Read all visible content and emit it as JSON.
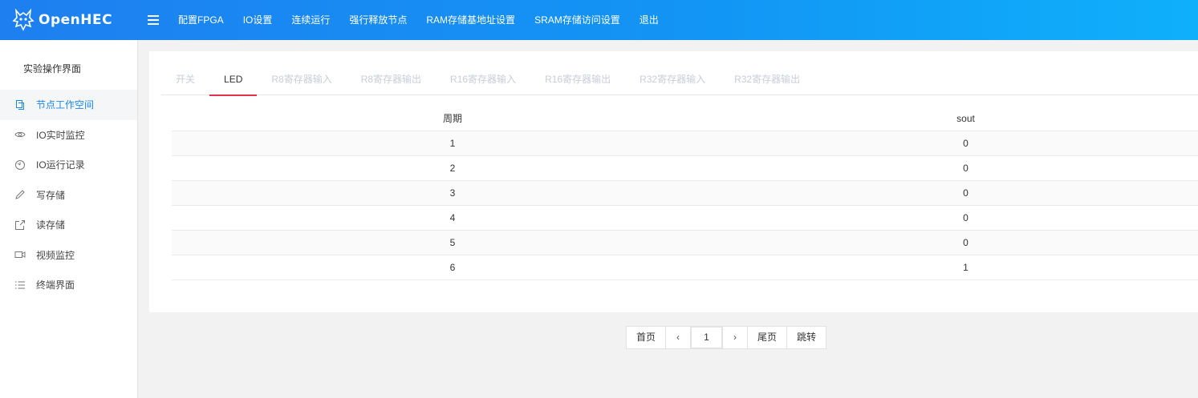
{
  "header": {
    "logo_text": "OpenHEC",
    "menu_icon": "hamburger-icon",
    "nav": [
      "配置FPGA",
      "IO设置",
      "连续运行",
      "强行释放节点",
      "RAM存储基地址设置",
      "SRAM存储访问设置",
      "退出"
    ]
  },
  "sidebar": {
    "title": "实验操作界面",
    "items": [
      {
        "label": "节点工作空间",
        "icon": "copy-icon",
        "active": true
      },
      {
        "label": "IO实时监控",
        "icon": "eye-icon"
      },
      {
        "label": "IO运行记录",
        "icon": "clock-icon"
      },
      {
        "label": "写存储",
        "icon": "pencil-icon"
      },
      {
        "label": "读存储",
        "icon": "export-icon"
      },
      {
        "label": "视频监控",
        "icon": "video-icon"
      },
      {
        "label": "终端界面",
        "icon": "list-icon"
      }
    ]
  },
  "tabs": [
    "开关",
    "LED",
    "R8寄存器输入",
    "R8寄存器输出",
    "R16寄存器输入",
    "R16寄存器输出",
    "R32寄存器输入",
    "R32寄存器输出"
  ],
  "active_tab": "LED",
  "table": {
    "columns": [
      "周期",
      "sout"
    ],
    "rows": [
      [
        "1",
        "0"
      ],
      [
        "2",
        "0"
      ],
      [
        "3",
        "0"
      ],
      [
        "4",
        "0"
      ],
      [
        "5",
        "0"
      ],
      [
        "6",
        "1"
      ]
    ]
  },
  "pager": {
    "first": "首页",
    "prev": "‹",
    "current": "1",
    "next": "›",
    "last": "尾页",
    "jump": "跳转"
  },
  "colors": {
    "topbar_start": "#1e7ff0",
    "topbar_end": "#0fb0fb",
    "active_tab_underline": "#e3334a",
    "active_sidebar_text": "#1e88e5"
  }
}
